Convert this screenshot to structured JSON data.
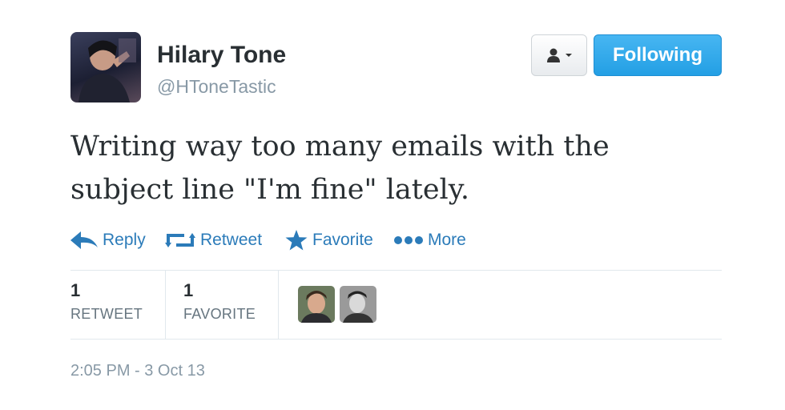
{
  "user": {
    "name": "Hilary Tone",
    "handle": "@HToneTastic"
  },
  "header": {
    "follow_label": "Following"
  },
  "tweet": {
    "line1": "Writing way too many emails with the",
    "line2": "subject line \"I'm fine\" lately."
  },
  "actions": [
    {
      "label": "Reply",
      "icon": "reply-icon"
    },
    {
      "label": "Retweet",
      "icon": "retweet-icon"
    },
    {
      "label": "Favorite",
      "icon": "star-icon"
    },
    {
      "label": "More",
      "icon": "more-dots-icon"
    }
  ],
  "stats": {
    "retweets": {
      "count": "1",
      "label": "RETWEET"
    },
    "favorites": {
      "count": "1",
      "label": "FAVORITE"
    }
  },
  "timestamp": "2:05 PM - 3 Oct 13",
  "colors": {
    "link": "#2b7bb9",
    "follow_button": "#2aa3e6",
    "muted": "#8899a6"
  }
}
